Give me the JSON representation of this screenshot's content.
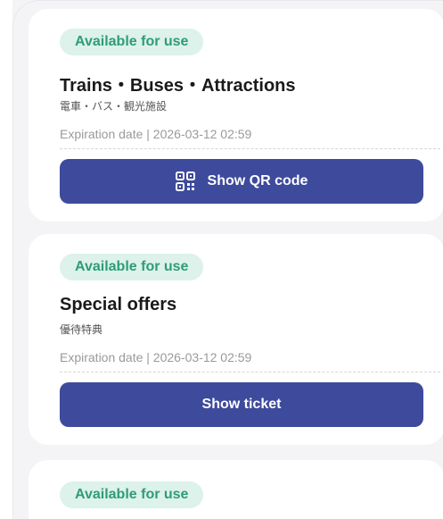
{
  "cards": [
    {
      "status": "Available for use",
      "title": "Trains・Buses・Attractions",
      "subtitle": "電車・バス・観光施設",
      "expiry": "Expiration date | 2026-03-12 02:59",
      "button_label": "Show QR code",
      "button_icon": "qr-code-icon"
    },
    {
      "status": "Available for use",
      "title": "Special offers",
      "subtitle": "優待特典",
      "expiry": "Expiration date | 2026-03-12 02:59",
      "button_label": "Show ticket"
    },
    {
      "status": "Available for use"
    }
  ],
  "colors": {
    "badge_bg": "#dcf2ea",
    "badge_text": "#2f9c78",
    "button_bg": "#3e4a9b",
    "sparkle": "#f5b800"
  }
}
